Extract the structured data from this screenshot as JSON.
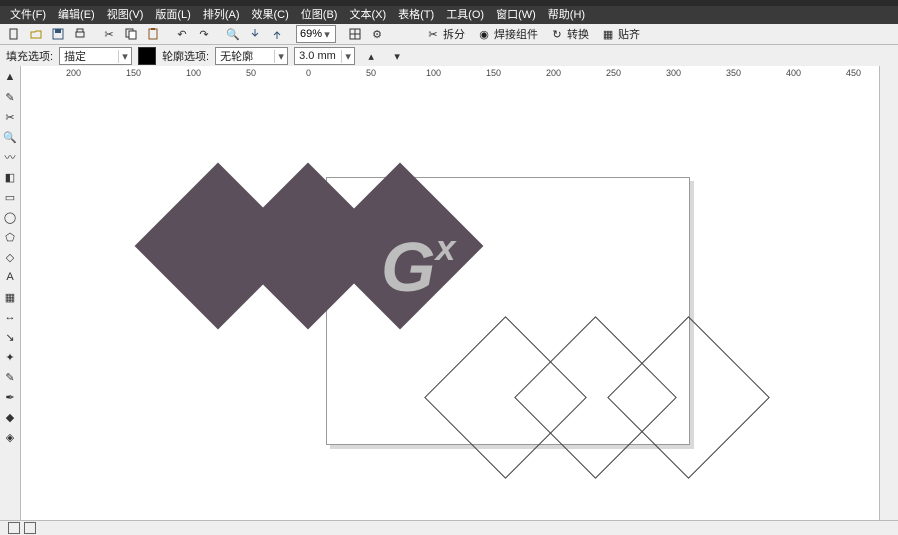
{
  "menu": {
    "file": "文件(F)",
    "edit": "编辑(E)",
    "view": "视图(V)",
    "layout": "版面(L)",
    "arrange": "排列(A)",
    "effects": "效果(C)",
    "bitmaps": "位图(B)",
    "text": "文本(X)",
    "table": "表格(T)",
    "tools": "工具(O)",
    "window": "窗口(W)",
    "help": "帮助(H)"
  },
  "toolbar": {
    "zoom": "69%",
    "break": "拆分",
    "weld": "焊接组件",
    "convert": "转换",
    "align": "贴齐"
  },
  "propbar": {
    "fill_label": "填充选项:",
    "fill_value": "描定",
    "outline_label": "轮廓选项:",
    "outline_value": "无轮廓",
    "outline_width": "3.0 mm"
  },
  "ruler": {
    "h": [
      "200",
      "150",
      "100",
      "50",
      "0",
      "50",
      "100",
      "150",
      "200",
      "250",
      "300",
      "350",
      "400",
      "450"
    ]
  },
  "status_text": "",
  "chart_data": {
    "type": "vector-canvas",
    "page": {
      "origin_x": 0,
      "origin_y": 0,
      "visible": true
    },
    "shapes": [
      {
        "kind": "diamond",
        "fill": "#5a4f5a",
        "outline": null,
        "overlap_group": 3
      },
      {
        "kind": "diamond",
        "fill": "#5a4f5a",
        "outline": null,
        "overlap_group": 3
      },
      {
        "kind": "diamond",
        "fill": "#5a4f5a",
        "outline": null,
        "overlap_group": 3
      },
      {
        "kind": "diamond",
        "fill": null,
        "outline": "#444",
        "overlap_group": 3
      },
      {
        "kind": "diamond",
        "fill": null,
        "outline": "#444",
        "overlap_group": 3
      },
      {
        "kind": "diamond",
        "fill": null,
        "outline": "#444",
        "overlap_group": 3
      }
    ],
    "watermark": "Gx"
  }
}
